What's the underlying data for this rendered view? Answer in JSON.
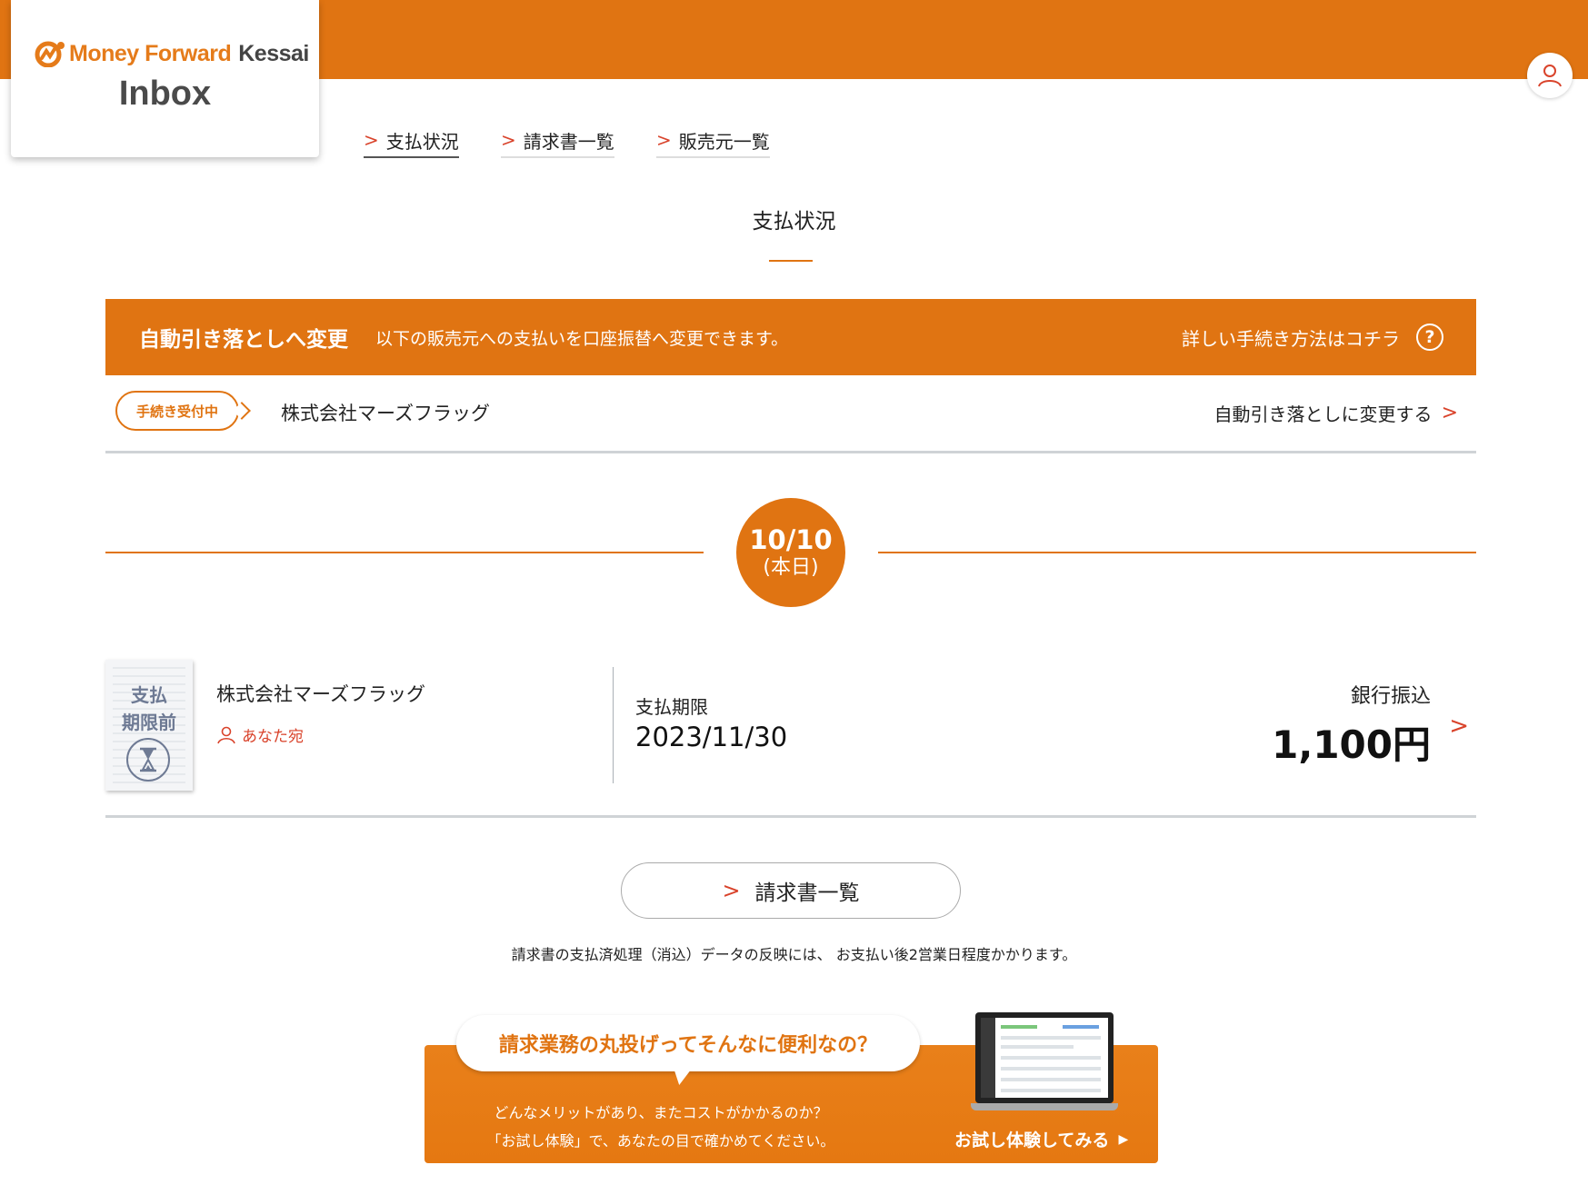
{
  "header": {
    "brand_money_forward": "Money Forward",
    "brand_kessai": "Kessai",
    "product": "Inbox"
  },
  "nav": [
    {
      "label": "支払状況"
    },
    {
      "label": "請求書一覧"
    },
    {
      "label": "販売元一覧"
    }
  ],
  "page": {
    "title": "支払状況"
  },
  "banner": {
    "title": "自動引き落としへ変更",
    "description": "以下の販売元への支払いを口座振替へ変更できます。",
    "help_link": "詳しい手続き方法はコチラ",
    "help_icon": "?"
  },
  "merchant_row": {
    "badge": "手続き受付中",
    "name": "株式会社マーズフラッグ",
    "action": "自動引き落としに変更する"
  },
  "date_marker": {
    "date": "10/10",
    "label": "(本日)"
  },
  "invoice": {
    "thumb_status_1": "支払",
    "thumb_status_2": "期限前",
    "merchant": "株式会社マーズフラッグ",
    "addressee": "あなた宛",
    "due_label": "支払期限",
    "due_date": "2023/11/30",
    "payment_method": "銀行振込",
    "amount": "1,100円"
  },
  "invoice_list_button": "請求書一覧",
  "note": "請求書の支払済処理（消込）データの反映には、 お支払い後2営業日程度かかります。",
  "promo": {
    "headline": "請求業務の丸投げってそんなに便利なの？",
    "line1": "どんなメリットがあり、またコストがかかるのか？",
    "line2": "「お試し体験」で、あなたの目で確かめてください。",
    "cta": "お試し体験してみる"
  },
  "colors": {
    "brand_orange": "#e07412",
    "accent_red": "#d9432b",
    "divider_gray": "#cfd3d6"
  }
}
